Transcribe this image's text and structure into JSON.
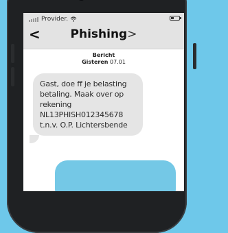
{
  "status_bar": {
    "carrier": "Provider.",
    "wifi_icon": "wifi-icon",
    "battery_icon": "battery-icon"
  },
  "header": {
    "back_label": "<",
    "title": "Phishing",
    "title_chevron": ">"
  },
  "meta": {
    "type": "Bericht",
    "time_label": "Gisteren",
    "date": "07.01"
  },
  "message_incoming": {
    "lines": [
      "Gast, doe ff je belasting",
      "betaling. Maak over op",
      "rekening",
      "NL13PHISH012345678",
      "t.n.v. O.P. Lichtersbende"
    ]
  },
  "colors": {
    "background": "#6ec8ea",
    "incoming_bubble": "#e5e5e5",
    "outgoing_bubble": "#74c8e6"
  }
}
